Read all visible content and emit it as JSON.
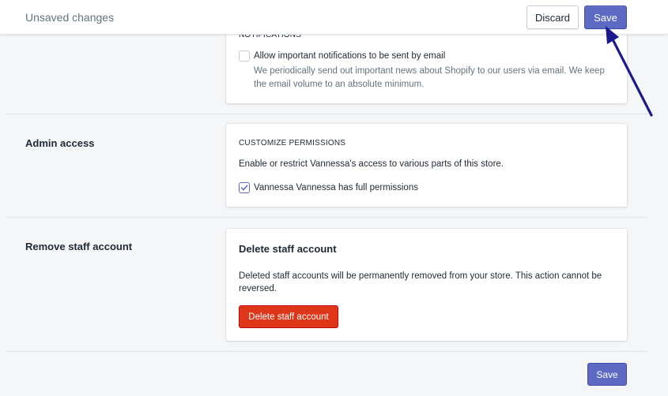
{
  "topbar": {
    "title": "Unsaved changes",
    "discard_label": "Discard",
    "save_label": "Save"
  },
  "notifications": {
    "heading": "NOTIFICATIONS",
    "checkbox_label": "Allow important notifications to be sent by email",
    "checkbox_checked": false,
    "help_line_1": "We periodically send out important news about Shopify to our users via email. We keep",
    "help_line_2": "the email volume to an absolute minimum."
  },
  "admin_access": {
    "section_label": "Admin access",
    "heading": "CUSTOMIZE PERMISSIONS",
    "description": "Enable or restrict Vannessa's access to various parts of this store.",
    "checkbox_label": "Vannessa Vannessa has full permissions",
    "checkbox_checked": true
  },
  "remove_staff": {
    "section_label": "Remove staff account",
    "card_title": "Delete staff account",
    "description_line_1": "Deleted staff accounts will be permanently removed from your store. This action cannot be",
    "description_line_2": "reversed.",
    "delete_label": "Delete staff account"
  },
  "footer": {
    "save_label": "Save"
  },
  "colors": {
    "primary": "#5c6ac4",
    "destructive": "#de3618",
    "annotation_arrow": "#1a1a8c"
  },
  "icons": {
    "checkmark": "checkmark-icon",
    "annotation": "arrow-annotation-icon"
  }
}
